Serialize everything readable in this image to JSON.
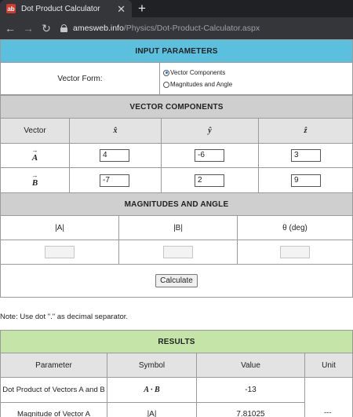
{
  "browser": {
    "tab_title": "Dot Product Calculator",
    "tab_favicon": "ab",
    "tab_close": "✕",
    "new_tab": "+",
    "url_host": "amesweb.info",
    "url_path": "/Physics/Dot-Product-Calculator.aspx"
  },
  "input_parameters": {
    "heading": "INPUT PARAMETERS",
    "vector_form_label": "Vector Form:",
    "options": [
      "Vector Components",
      "Magnitudes and Angle"
    ],
    "selected": "Vector Components"
  },
  "vector_components": {
    "heading": "VECTOR COMPONENTS",
    "headers": [
      "Vector",
      "x̂",
      "ŷ",
      "ẑ"
    ],
    "rows": [
      {
        "vector": "A",
        "values": [
          "4",
          "-6",
          "3"
        ]
      },
      {
        "vector": "B",
        "values": [
          "-7",
          "2",
          "9"
        ]
      }
    ]
  },
  "magnitudes_angle": {
    "heading": "MAGNITUDES AND ANGLE",
    "headers": [
      "|A|",
      "|B|",
      "θ (deg)"
    ],
    "values": [
      "",
      "",
      ""
    ]
  },
  "calculate_label": "Calculate",
  "note": "Note: Use dot \".\" as decimal separator.",
  "results": {
    "heading": "RESULTS",
    "headers": [
      "Parameter",
      "Symbol",
      "Value",
      "Unit"
    ],
    "rows": [
      {
        "parameter": "Dot Product of Vectors A and B",
        "symbol": "A · B",
        "value": "-13",
        "unit": ""
      },
      {
        "parameter": "Magnitude of Vector A",
        "symbol": "|A|",
        "value": "7.81025",
        "unit": "---"
      }
    ]
  },
  "colors": {
    "input_header": "#5bc0de",
    "section_header": "#cfcfcf",
    "results_header": "#c4e4a8"
  }
}
